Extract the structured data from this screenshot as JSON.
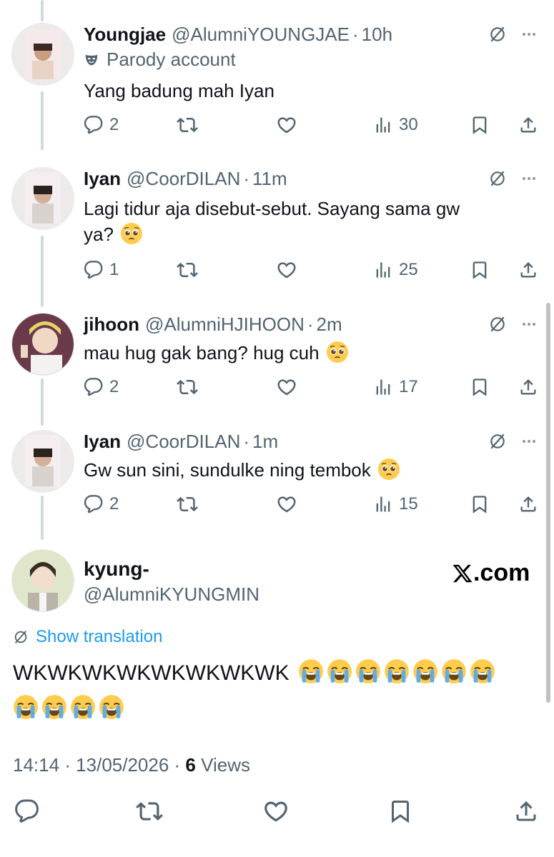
{
  "replies": [
    {
      "name": "Youngjae",
      "handle": "@AlumniYOUNGJAE",
      "time": "10h",
      "badge": "Parody account",
      "text": "Yang badung mah Iyan",
      "replies": "2",
      "views": "30"
    },
    {
      "name": "Iyan",
      "handle": "@CoorDILAN",
      "time": "11m",
      "text_line1": "Lagi tidur aja disebut-sebut. Sayang sama gw",
      "text_line2": "ya?",
      "replies": "1",
      "views": "25"
    },
    {
      "name": "jihoon",
      "handle": "@AlumniHJIHOON",
      "time": "2m",
      "text": "mau hug gak bang? hug cuh",
      "replies": "2",
      "views": "17"
    },
    {
      "name": "Iyan",
      "handle": "@CoorDILAN",
      "time": "1m",
      "text": "Gw sun sini, sundulke ning tembok",
      "replies": "2",
      "views": "15"
    }
  ],
  "main_tweet": {
    "name": "kyung-",
    "handle": "@AlumniKYUNGMIN",
    "logo_text": ".com",
    "show_translation": "Show translation",
    "text": "WKWKWKWKWKWKWKWK",
    "timestamp": "14:14 · 13/05/2026 · ",
    "views_count": "6",
    "views_label": " Views"
  },
  "icons": [
    "reply-icon",
    "retweet-icon",
    "like-icon",
    "views-icon",
    "bookmark-icon",
    "share-icon",
    "globe-icon",
    "more-icon",
    "parody-mask-icon",
    "pleading-face-emoji",
    "crying-face-emoji"
  ],
  "colors": {
    "text": "#0f1419",
    "secondary": "#536471",
    "link": "#1d9bf0",
    "thread_line": "#cfd9de"
  }
}
